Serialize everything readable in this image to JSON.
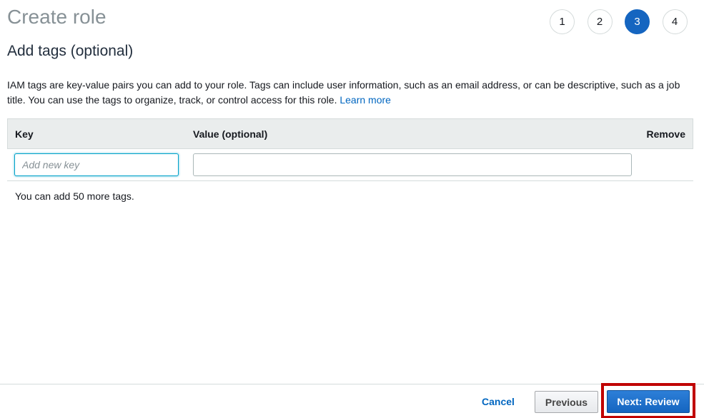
{
  "header": {
    "title": "Create role",
    "steps": [
      {
        "label": "1",
        "active": false
      },
      {
        "label": "2",
        "active": false
      },
      {
        "label": "3",
        "active": true
      },
      {
        "label": "4",
        "active": false
      }
    ]
  },
  "section": {
    "title": "Add tags (optional)",
    "description": "IAM tags are key-value pairs you can add to your role. Tags can include user information, such as an email address, or can be descriptive, such as a job title. You can use the tags to organize, track, or control access for this role.",
    "learn_more": "Learn more"
  },
  "tags_table": {
    "columns": {
      "key": "Key",
      "value": "Value (optional)",
      "remove": "Remove"
    },
    "key_placeholder": "Add new key",
    "key_value": "",
    "value_value": "",
    "remaining_text": "You can add 50 more tags."
  },
  "footer": {
    "cancel_label": "Cancel",
    "previous_label": "Previous",
    "next_label": "Next: Review"
  },
  "colors": {
    "accent": "#1565c0",
    "link": "#0066c0",
    "highlight": "#c00000"
  }
}
